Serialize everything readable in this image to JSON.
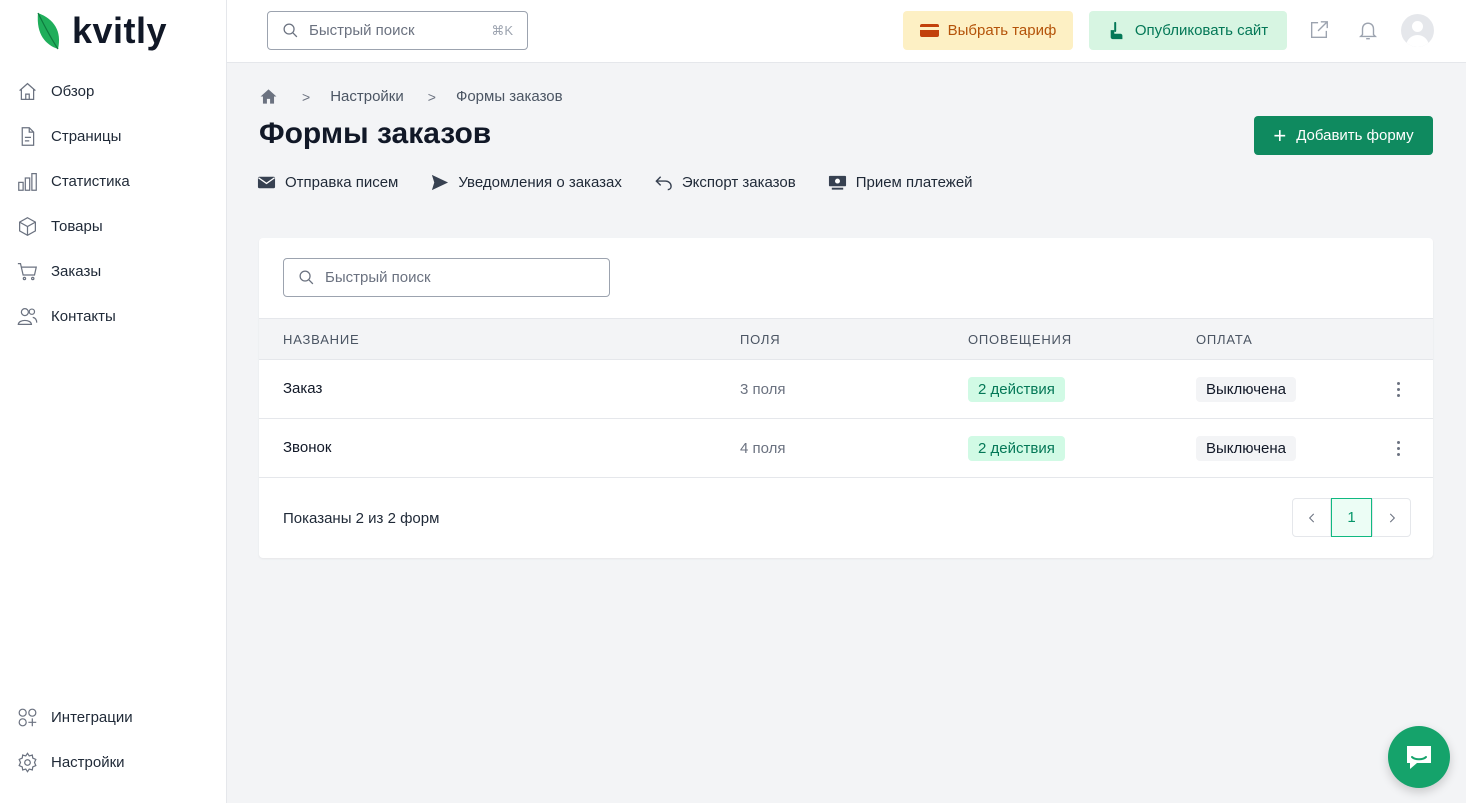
{
  "app": {
    "logo_text": "kvitly"
  },
  "sidebar": {
    "items": [
      {
        "label": "Обзор",
        "icon": "home-outline-icon"
      },
      {
        "label": "Страницы",
        "icon": "file-icon"
      },
      {
        "label": "Статистика",
        "icon": "bar-chart-icon"
      },
      {
        "label": "Товары",
        "icon": "cube-icon"
      },
      {
        "label": "Заказы",
        "icon": "cart-icon"
      },
      {
        "label": "Контакты",
        "icon": "users-icon"
      }
    ],
    "bottom": [
      {
        "label": "Интеграции",
        "icon": "apps-icon"
      },
      {
        "label": "Настройки",
        "icon": "gear-icon"
      }
    ]
  },
  "topbar": {
    "search_placeholder": "Быстрый поиск",
    "search_shortcut": "⌘K",
    "tariff_label": "Выбрать тариф",
    "publish_label": "Опубликовать сайт"
  },
  "breadcrumb": {
    "items": [
      "Настройки",
      "Формы заказов"
    ]
  },
  "page": {
    "title": "Формы заказов",
    "add_button": "Добавить форму"
  },
  "subnav": [
    "Отправка писем",
    "Уведомления о заказах",
    "Экспорт заказов",
    "Прием платежей"
  ],
  "table": {
    "search_placeholder": "Быстрый поиск",
    "columns": [
      "НАЗВАНИЕ",
      "ПОЛЯ",
      "ОПОВЕЩЕНИЯ",
      "ОПЛАТА"
    ],
    "rows": [
      {
        "name": "Заказ",
        "fields": "3 поля",
        "notifications": "2 действия",
        "payment": "Выключена"
      },
      {
        "name": "Звонок",
        "fields": "4 поля",
        "notifications": "2 действия",
        "payment": "Выключена"
      }
    ],
    "footer": "Показаны 2 из 2 форм",
    "current_page": "1"
  },
  "colors": {
    "brand": "#0f8a5f",
    "accent_light": "#d7f5e2",
    "warning_bg": "#fdf0c4"
  }
}
